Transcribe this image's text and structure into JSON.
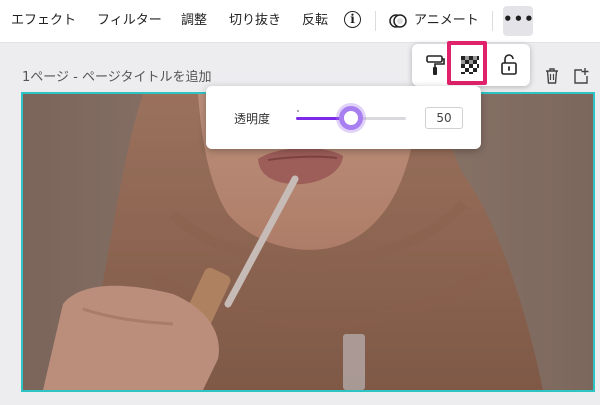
{
  "toolbar": {
    "effects": "エフェクト",
    "filter": "フィルター",
    "adjust": "調整",
    "crop": "切り抜き",
    "flip": "反転",
    "animate": "アニメート",
    "more": "•••",
    "info_icon": "info-icon",
    "animate_icon": "animate-icon"
  },
  "page": {
    "title": "1ページ - ページタイトルを追加",
    "icons": [
      "trash-icon",
      "add-page-icon"
    ]
  },
  "popover": {
    "icons": [
      "paint-roller-icon",
      "transparency-icon",
      "unlock-icon"
    ]
  },
  "transparency": {
    "label": "透明度",
    "value": "50",
    "fraction": 0.5
  },
  "colors": {
    "accent": "#7d2ae8",
    "highlight": "#e0216b",
    "selection": "#2ec4c4"
  }
}
